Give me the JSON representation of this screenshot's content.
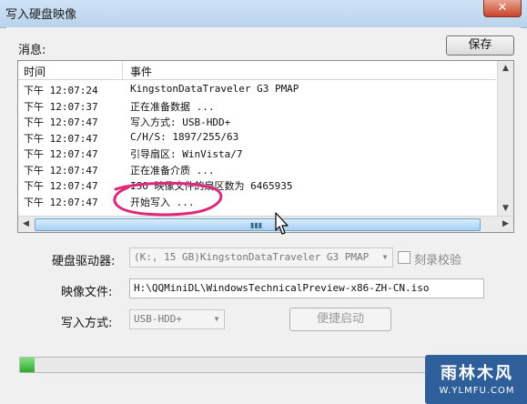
{
  "window": {
    "title": "写入硬盘映像",
    "close_glyph": "✕"
  },
  "messages_label": "消息:",
  "save_button": "保存",
  "log": {
    "columns": {
      "time": "时间",
      "event": "事件"
    },
    "rows": [
      {
        "time": "下午 12:07:24",
        "event": "KingstonDataTraveler G3 PMAP"
      },
      {
        "time": "下午 12:07:37",
        "event": "正在准备数据 ..."
      },
      {
        "time": "下午 12:07:47",
        "event": "写入方式: USB-HDD+"
      },
      {
        "time": "下午 12:07:47",
        "event": "C/H/S: 1897/255/63"
      },
      {
        "time": "下午 12:07:47",
        "event": "引导扇区: WinVista/7"
      },
      {
        "time": "下午 12:07:47",
        "event": "正在准备介质 ..."
      },
      {
        "time": "下午 12:07:47",
        "event": "ISO 映像文件的扇区数为 6465935"
      },
      {
        "time": "下午 12:07:47",
        "event": "开始写入 ..."
      }
    ]
  },
  "form": {
    "drive_label": "硬盘驱动器:",
    "drive_value": "(K:, 15 GB)KingstonDataTraveler G3 PMAP",
    "verify_label": "刻录校验",
    "image_label": "映像文件:",
    "image_value": "H:\\QQMiniDL\\WindowsTechnicalPreview-x86-ZH-CN.iso",
    "mode_label": "写入方式:",
    "mode_value": "USB-HDD+",
    "quick_boot_button": "便捷启动"
  },
  "progress": {
    "fraction": 0.03
  },
  "watermark": {
    "main": "雨林木风",
    "sub": "W.YLMFU.COM"
  },
  "colors": {
    "annotation": "#e0287a",
    "progress": "#2ea92b",
    "accent": "#2e5f9b"
  },
  "icons": {
    "close": "close-icon",
    "dropdown": "chevron-down-icon",
    "scroll_up": "arrow-up-icon",
    "scroll_down": "arrow-down-icon",
    "scroll_left": "arrow-left-icon",
    "scroll_right": "arrow-right-icon"
  }
}
